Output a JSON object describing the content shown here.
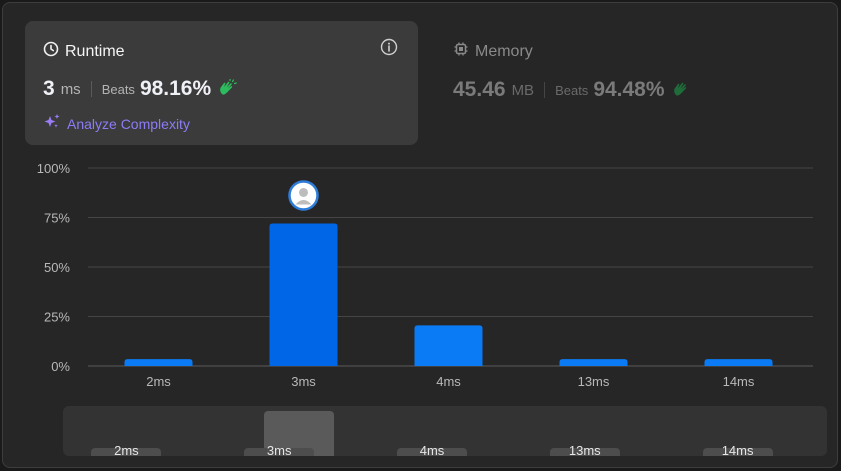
{
  "runtime": {
    "title": "Runtime",
    "value": "3",
    "unit": "ms",
    "beats_label": "Beats",
    "beats_value": "98.16%",
    "analyze_label": "Analyze Complexity"
  },
  "memory": {
    "title": "Memory",
    "value": "45.46",
    "unit": "MB",
    "beats_label": "Beats",
    "beats_value": "94.48%"
  },
  "colors": {
    "bar": "#0a7bf5",
    "bar_active": "#0066e8",
    "accent_purple": "#8b7cf6",
    "hand_green": "#2cbb5d"
  },
  "chart_data": {
    "type": "bar",
    "categories": [
      "2ms",
      "3ms",
      "4ms",
      "13ms",
      "14ms"
    ],
    "values": [
      3.5,
      72,
      20.5,
      3.5,
      3.5
    ],
    "ylim": [
      0,
      100
    ],
    "yticks": [
      "0%",
      "25%",
      "50%",
      "75%",
      "100%"
    ],
    "selected": "3ms",
    "grid": true
  },
  "scroller": {
    "labels": [
      "2ms",
      "3ms",
      "4ms",
      "13ms",
      "14ms"
    ]
  }
}
